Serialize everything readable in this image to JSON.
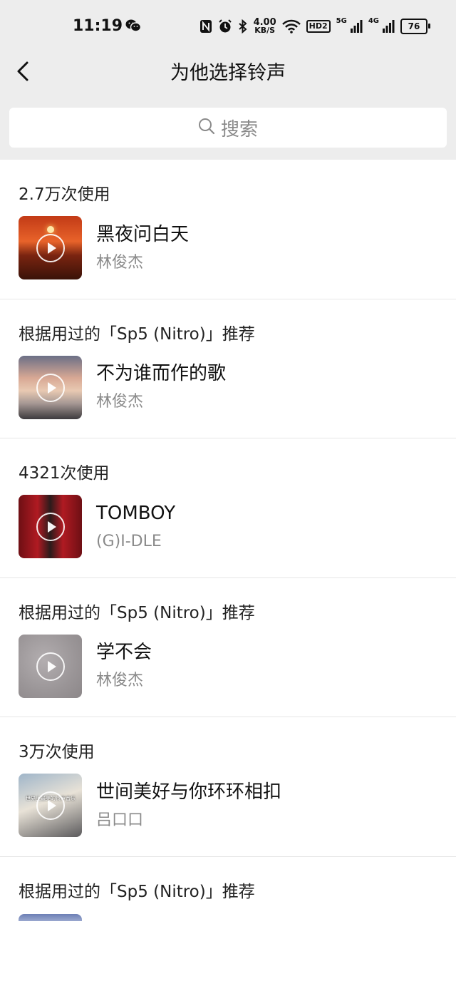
{
  "status": {
    "time": "11:19",
    "speed_value": "4.00",
    "speed_unit": "KB/S",
    "hd_badge": "HD2",
    "net_1": "5G",
    "net_2": "4G",
    "battery": "76"
  },
  "nav": {
    "title": "为他选择铃声"
  },
  "search": {
    "placeholder": "搜索"
  },
  "sections": [
    {
      "label": "2.7万次使用",
      "title": "黑夜问白天",
      "artist": "林俊杰"
    },
    {
      "label": "根据用过的「Sp5 (Nitro)」推荐",
      "title": "不为谁而作的歌",
      "artist": "林俊杰"
    },
    {
      "label": "4321次使用",
      "title": "TOMBOY",
      "artist": "(G)I-DLE"
    },
    {
      "label": "根据用过的「Sp5 (Nitro)」推荐",
      "title": "学不会",
      "artist": "林俊杰"
    },
    {
      "label": "3万次使用",
      "title": "世间美好与你环环相扣",
      "artist": "吕口口",
      "cover_caption": "世界上最美的铃声音乐"
    },
    {
      "label": "根据用过的「Sp5 (Nitro)」推荐"
    }
  ]
}
